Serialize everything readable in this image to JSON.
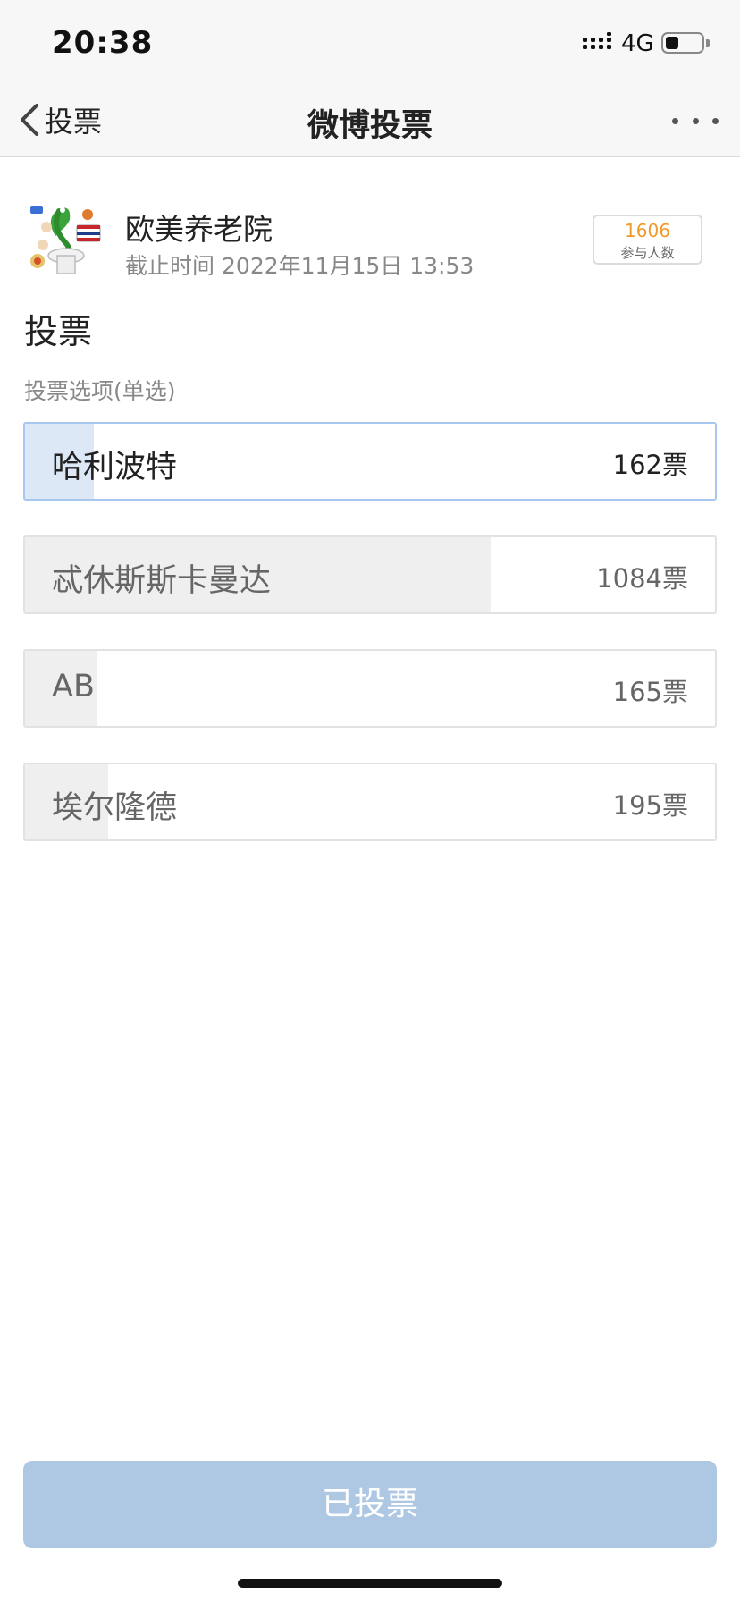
{
  "status_bar": {
    "time": "20:38",
    "network": "4G",
    "battery_level": 0.35,
    "icons": [
      "signal-icon",
      "battery-icon"
    ]
  },
  "nav": {
    "back_label": "投票",
    "title": "微博投票",
    "icons": [
      "chevron-left-icon",
      "more-icon"
    ]
  },
  "poll": {
    "author": "欧美养老院",
    "deadline_label": "截止时间",
    "deadline": "2022年11月15日 13:53",
    "participants_count": "1606",
    "participants_label": "参与人数",
    "heading": "投票",
    "type_label": "投票选项(单选)",
    "options": [
      {
        "label": "哈利波特",
        "votes": "162票",
        "share": 0.1,
        "selected": true
      },
      {
        "label": "忒休斯斯卡曼达",
        "votes": "1084票",
        "share": 0.675,
        "selected": false
      },
      {
        "label": "AB",
        "votes": "165票",
        "share": 0.103,
        "selected": false
      },
      {
        "label": "埃尔隆德",
        "votes": "195票",
        "share": 0.121,
        "selected": false
      }
    ]
  },
  "submit_label": "已投票",
  "colors": {
    "accent_orange": "#f09a2a",
    "selected_border": "#a8c7ef",
    "selected_fill": "#dce8f5",
    "bar_fill": "#efefef",
    "button_bg": "#aec8e3"
  }
}
